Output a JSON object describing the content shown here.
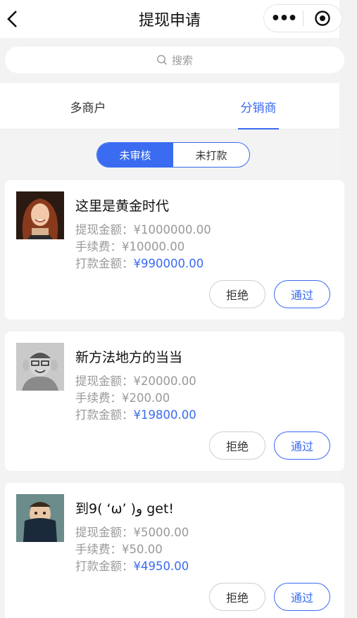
{
  "nav": {
    "title": "提现申请",
    "back_icon": "chevron-left-icon",
    "more_label": "•••",
    "target_icon": "record-icon"
  },
  "search": {
    "placeholder": "搜索"
  },
  "tabs": [
    {
      "label": "多商户",
      "active": false
    },
    {
      "label": "分销商",
      "active": true
    }
  ],
  "filter": [
    {
      "label": "未审核",
      "active": true
    },
    {
      "label": "未打款",
      "active": false
    }
  ],
  "colors": {
    "accent": "#3a6bf0",
    "muted": "#999999",
    "background": "#f3f3f3"
  },
  "labels": {
    "withdraw": "提现金额：",
    "fee": "手续费：",
    "payout": "打款金额："
  },
  "cards": [
    {
      "name": "这里是黄金时代",
      "withdraw": "¥1000000.00",
      "fee": "¥10000.00",
      "payout": "¥990000.00",
      "reject_label": "拒绝",
      "approve_label": "通过"
    },
    {
      "name": "新方法地方的当当",
      "withdraw": "¥20000.00",
      "fee": "¥200.00",
      "payout": "¥19800.00",
      "reject_label": "拒绝",
      "approve_label": "通过"
    },
    {
      "name": "到9( ‘ω’ )و get!",
      "withdraw": "¥5000.00",
      "fee": "¥50.00",
      "payout": "¥4950.00",
      "reject_label": "拒绝",
      "approve_label": "通过"
    }
  ]
}
